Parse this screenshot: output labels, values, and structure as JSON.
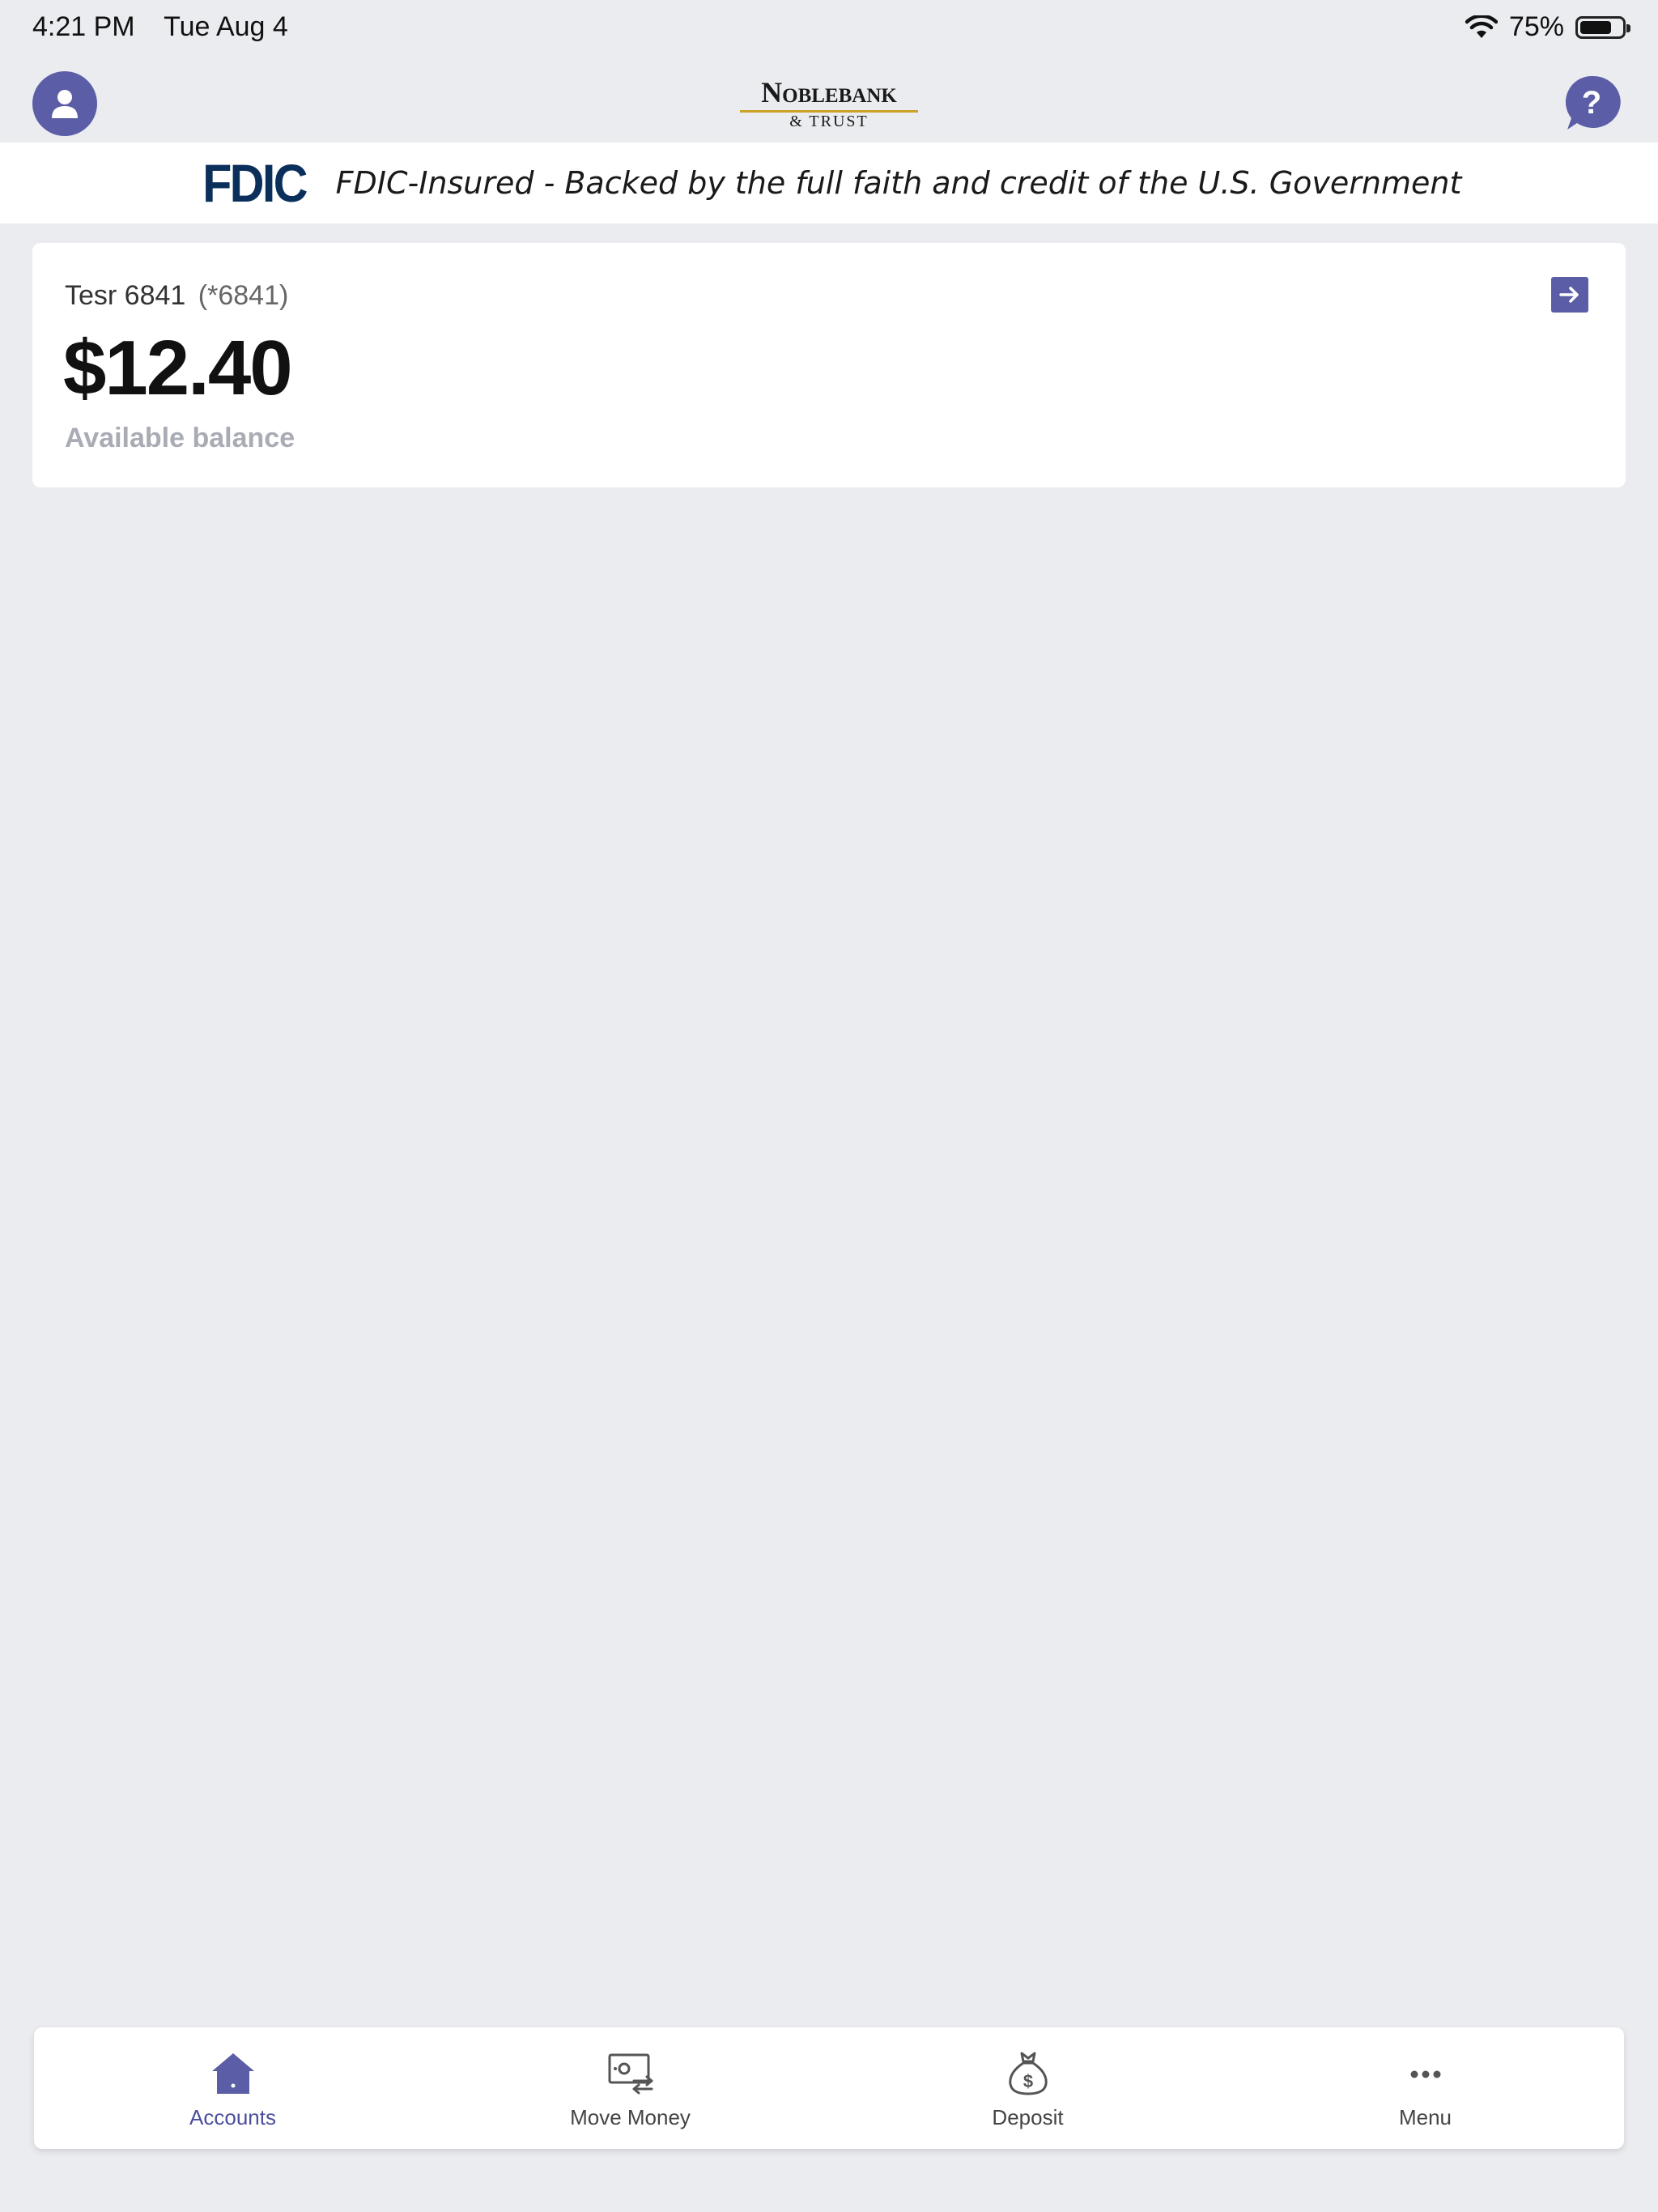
{
  "status_bar": {
    "time": "4:21 PM",
    "date": "Tue Aug 4",
    "battery": "75%",
    "battery_level": 0.75
  },
  "header": {
    "logo_main": "Noblebank",
    "logo_sub": "& TRUST",
    "profile_icon": "person-icon",
    "help_icon": "question-bubble-icon",
    "accent_color": "#5b5ea6"
  },
  "fdic": {
    "logo": "FDIC",
    "text": "FDIC-Insured - Backed by the full faith and credit of the U.S. Government"
  },
  "account": {
    "name": "Tesr 6841",
    "mask": "(*6841)",
    "balance": "$12.40",
    "balance_label": "Available balance",
    "arrow_icon": "arrow-right-icon"
  },
  "nav": {
    "items": [
      {
        "label": "Accounts",
        "icon": "home-icon",
        "active": true
      },
      {
        "label": "Move Money",
        "icon": "money-transfer-icon",
        "active": false
      },
      {
        "label": "Deposit",
        "icon": "money-bag-icon",
        "active": false
      },
      {
        "label": "Menu",
        "icon": "more-dots-icon",
        "active": false
      }
    ]
  }
}
